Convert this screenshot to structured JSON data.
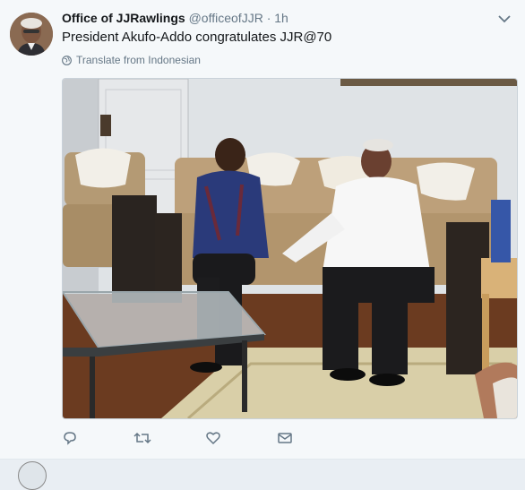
{
  "tweet": {
    "author_name": "Office of JJRawlings",
    "author_handle": "@officeofJJR",
    "separator": "·",
    "time": "1h",
    "text": "President Akufo-Addo congratulates JJR@70",
    "translate_label": "Translate from Indonesian"
  },
  "icons": {
    "avatar": "profile-photo",
    "menu": "chevron-down-icon",
    "translate": "globe-icon",
    "reply": "reply-icon",
    "retweet": "retweet-icon",
    "like": "heart-icon",
    "message": "envelope-icon"
  },
  "colors": {
    "background": "#f5f8fa",
    "name": "#14171a",
    "meta": "#657786",
    "icon": "#657786"
  }
}
